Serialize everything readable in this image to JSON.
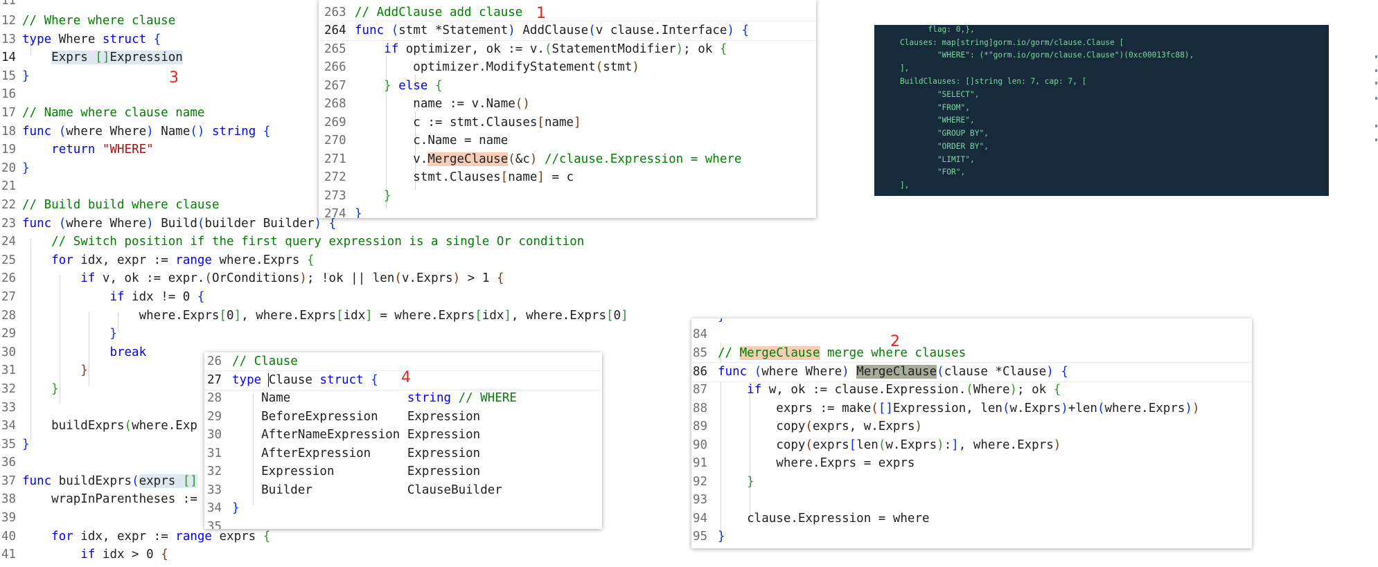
{
  "main_editor": {
    "lines": [
      {
        "n": "11",
        "t": ""
      },
      {
        "n": "12",
        "t": "// Where where clause"
      },
      {
        "n": "13",
        "t": "type Where struct {"
      },
      {
        "n": "14",
        "t": "    Exprs []Expression"
      },
      {
        "n": "15",
        "t": "}"
      },
      {
        "n": "16",
        "t": ""
      },
      {
        "n": "17",
        "t": "// Name where clause name"
      },
      {
        "n": "18",
        "t": "func (where Where) Name() string {"
      },
      {
        "n": "19",
        "t": "    return \"WHERE\""
      },
      {
        "n": "20",
        "t": "}"
      },
      {
        "n": "21",
        "t": ""
      },
      {
        "n": "22",
        "t": "// Build build where clause"
      },
      {
        "n": "23",
        "t": "func (where Where) Build(builder Builder) {"
      },
      {
        "n": "24",
        "t": "    // Switch position if the first query expression is a single Or condition"
      },
      {
        "n": "25",
        "t": "    for idx, expr := range where.Exprs {"
      },
      {
        "n": "26",
        "t": "        if v, ok := expr.(OrConditions); !ok || len(v.Exprs) > 1 {"
      },
      {
        "n": "27",
        "t": "            if idx != 0 {"
      },
      {
        "n": "28",
        "t": "                where.Exprs[0], where.Exprs[idx] = where.Exprs[idx], where.Exprs[0]"
      },
      {
        "n": "29",
        "t": "            }"
      },
      {
        "n": "30",
        "t": "            break"
      },
      {
        "n": "31",
        "t": "        }"
      },
      {
        "n": "32",
        "t": "    }"
      },
      {
        "n": "33",
        "t": ""
      },
      {
        "n": "34",
        "t": "    buildExprs(where.Exp"
      },
      {
        "n": "35",
        "t": "}"
      },
      {
        "n": "36",
        "t": ""
      },
      {
        "n": "37",
        "t": "func buildExprs(exprs []"
      },
      {
        "n": "38",
        "t": "    wrapInParentheses :="
      },
      {
        "n": "39",
        "t": ""
      },
      {
        "n": "40",
        "t": "    for idx, expr := range exprs {"
      },
      {
        "n": "41",
        "t": "        if idx > 0 {"
      }
    ]
  },
  "panel_addclause": {
    "lines": [
      {
        "n": "263",
        "t": "// AddClause add clause"
      },
      {
        "n": "264",
        "t": "func (stmt *Statement) AddClause(v clause.Interface) {"
      },
      {
        "n": "265",
        "t": "    if optimizer, ok := v.(StatementModifier); ok {"
      },
      {
        "n": "266",
        "t": "        optimizer.ModifyStatement(stmt)"
      },
      {
        "n": "267",
        "t": "    } else {"
      },
      {
        "n": "268",
        "t": "        name := v.Name()"
      },
      {
        "n": "269",
        "t": "        c := stmt.Clauses[name]"
      },
      {
        "n": "270",
        "t": "        c.Name = name"
      },
      {
        "n": "271",
        "t": "        v.MergeClause(&c) //clause.Expression = where"
      },
      {
        "n": "272",
        "t": "        stmt.Clauses[name] = c"
      },
      {
        "n": "273",
        "t": "    }"
      },
      {
        "n": "274",
        "t": "}"
      }
    ]
  },
  "panel_clause": {
    "lines": [
      {
        "n": "26",
        "t": "// Clause"
      },
      {
        "n": "27",
        "t": "type Clause struct {"
      },
      {
        "n": "28",
        "t": "    Name                string // WHERE"
      },
      {
        "n": "29",
        "t": "    BeforeExpression    Expression"
      },
      {
        "n": "30",
        "t": "    AfterNameExpression Expression"
      },
      {
        "n": "31",
        "t": "    AfterExpression     Expression"
      },
      {
        "n": "32",
        "t": "    Expression          Expression"
      },
      {
        "n": "33",
        "t": "    Builder             ClauseBuilder"
      },
      {
        "n": "34",
        "t": "}"
      },
      {
        "n": "35",
        "t": ""
      }
    ]
  },
  "panel_merge": {
    "lines": [
      {
        "n": "84",
        "t": ""
      },
      {
        "n": "85",
        "t": "// MergeClause merge where clauses"
      },
      {
        "n": "86",
        "t": "func (where Where) MergeClause(clause *Clause) {"
      },
      {
        "n": "87",
        "t": "    if w, ok := clause.Expression.(Where); ok {"
      },
      {
        "n": "88",
        "t": "        exprs := make([]Expression, len(w.Exprs)+len(where.Exprs))"
      },
      {
        "n": "89",
        "t": "        copy(exprs, w.Exprs)"
      },
      {
        "n": "90",
        "t": "        copy(exprs[len(w.Exprs):], where.Exprs)"
      },
      {
        "n": "91",
        "t": "        where.Exprs = exprs"
      },
      {
        "n": "92",
        "t": "    }"
      },
      {
        "n": "93",
        "t": ""
      },
      {
        "n": "94",
        "t": "    clause.Expression = where"
      },
      {
        "n": "95",
        "t": "}"
      }
    ]
  },
  "debug_output": {
    "lines": [
      "          flag: 0,},",
      "    Clauses: map[string]gorm.io/gorm/clause.Clause [",
      "            \"WHERE\": (*\"gorm.io/gorm/clause.Clause\")(0xc00013fc88),",
      "    ],",
      "    BuildClauses: []string len: 7, cap: 7, [",
      "            \"SELECT\",",
      "            \"FROM\",",
      "            \"WHERE\",",
      "            \"GROUP BY\",",
      "            \"ORDER BY\",",
      "            \"LIMIT\",",
      "            \"FOR\",",
      "    ],"
    ]
  },
  "annotations": {
    "a1": "1",
    "a2": "2",
    "a3": "3",
    "a4": "4"
  },
  "colors": {
    "keyword": "#0000ff",
    "comment": "#008000",
    "string": "#a31515",
    "annotation": "#e8231c",
    "debug_bg": "#162a3a",
    "debug_text": "#7ed6a3"
  }
}
